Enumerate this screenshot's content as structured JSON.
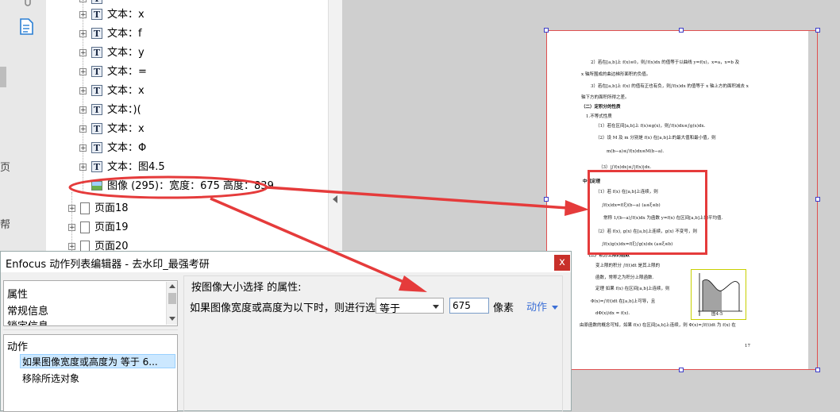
{
  "tree": {
    "rows": [
      {
        "type": "text",
        "label": "文本：x"
      },
      {
        "type": "text",
        "label": "文本：f"
      },
      {
        "type": "text",
        "label": "文本：y"
      },
      {
        "type": "text",
        "label": "文本：="
      },
      {
        "type": "text",
        "label": "文本：x"
      },
      {
        "type": "text",
        "label": "文本：)("
      },
      {
        "type": "text",
        "label": "文本：x"
      },
      {
        "type": "text",
        "label": "文本：Φ"
      },
      {
        "type": "text",
        "label": "文本：图4.5"
      },
      {
        "type": "image",
        "label": "图像 (295)：宽度：675 高度：839"
      }
    ],
    "pages": [
      "页面18",
      "页面19",
      "页面20"
    ]
  },
  "left_strip": {
    "partial_labels": [
      "页",
      "帮"
    ]
  },
  "dialog": {
    "title": "Enfocus 动作列表编辑器 - 去水印_最强考研",
    "close_label": "x",
    "attr_items": [
      "属性",
      "常规信息",
      "锁定信息"
    ],
    "actions_header": "动作",
    "actions": [
      "如果图像宽度或高度为 等于 6...",
      "移除所选对象"
    ],
    "props_header": "按图像大小选择 的属性:",
    "condition_label": "如果图像宽度或高度为以下时，则进行选择",
    "select_value": "等于",
    "input_value": "675",
    "unit": "像素",
    "action_link": "动作"
  },
  "document": {
    "lines": [
      "2）若在[a,b]上 f(x)≤0，则∫f(x)dx 的值等于以曲线 y=f(x)，x=a，x=b 及",
      "x 轴所围成的曲边梯形面积的负值。",
      "3）若在[a,b]上 f(x) 的值有正也有负，则∫f(x)dx 的值等于 x 轴上方的面积减去 x",
      "轴下方的面积所得之差。",
      "（二）定积分的性质",
      "1.不等式性质",
      "（1）若在区间[a,b]上 f(x)≤g(x)，则∫f(x)dx≤∫g(x)dx.",
      "（2）设 M 及 m 分别是 f(x) 在[a,b]上的最大值和最小值，则",
      "m(b−a)≤∫f(x)dx≤M(b−a).",
      "（3）|∫f(x)dx|≤∫|f(x)|dx.",
      "中值定理",
      "（1）若 f(x) 在[a,b]上连续，则",
      "∫f(x)dx=f(ξ)(b−a)   (a≤ξ≤b)",
      "常称 1/(b−a)∫f(x)dx 为函数 y=f(x) 在区间[a,b]上的平均值.",
      "（2）若 f(x), g(x) 在[a,b]上连续，g(x) 不变号，则",
      "∫f(x)g(x)dx=f(ξ)∫g(x)dx   (a≤ξ≤b)",
      "（三）积分上限的函数",
      "变上限的积分 ∫f(t)dt 是其上限的",
      "函数，常称之为积分上限函数.",
      "定理 如果 f(x) 在区间[a,b]上连续，则",
      "Φ(x)=∫f(t)dt 在[a,b]上可导，且",
      "dΦ(x)/dx = f(x).",
      "由原函数的概念可知，如果 f(x) 在区间[a,b]上连续，则 Φ(x)=∫f(t)dt 为 f(x) 在",
      "图4-5",
      "17"
    ]
  }
}
